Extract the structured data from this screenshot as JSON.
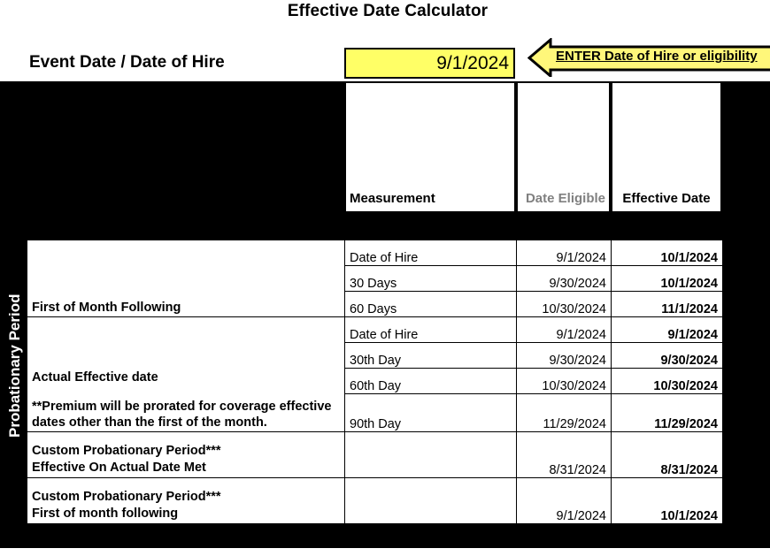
{
  "title": "Effective Date Calculator",
  "event_row": {
    "label": "Event Date / Date of Hire",
    "input_value": "9/1/2024",
    "callout_text": "ENTER Date of Hire or eligibility"
  },
  "side_label": "Probationary Period",
  "headers": {
    "measurement": "Measurement",
    "date_eligible": "Date Eligible",
    "effective_date": "Effective Date"
  },
  "colors": {
    "input_yellow": "#FFFF00",
    "callout_yellow": "#FFF77A",
    "custom_peach": "#F6BE8F",
    "custom_red_text": "#BE0000",
    "eligible_gray": "#8C8C8C",
    "backdrop": "#000000"
  },
  "rows": [
    {
      "category": "First of Month Following",
      "category_note": "",
      "measurement": "Date of Hire",
      "date_eligible": "9/1/2024",
      "effective_date": "10/1/2024"
    },
    {
      "category": "",
      "category_note": "",
      "measurement": "30 Days",
      "date_eligible": "9/30/2024",
      "effective_date": "10/1/2024"
    },
    {
      "category": "",
      "category_note": "",
      "measurement": "60 Days",
      "date_eligible": "10/30/2024",
      "effective_date": "11/1/2024"
    },
    {
      "category": "Actual Effective date",
      "category_note": "**Premium will be prorated for coverage effective dates other than the first of the month.",
      "measurement": "Date of Hire",
      "date_eligible": "9/1/2024",
      "effective_date": "9/1/2024"
    },
    {
      "category": "",
      "category_note": "",
      "measurement": "30th Day",
      "date_eligible": "9/30/2024",
      "effective_date": "9/30/2024"
    },
    {
      "category": "",
      "category_note": "",
      "measurement": "60th Day",
      "date_eligible": "10/30/2024",
      "effective_date": "10/30/2024"
    },
    {
      "category": "",
      "category_note": "",
      "measurement": "90th Day",
      "date_eligible": "11/29/2024",
      "effective_date": "11/29/2024"
    }
  ],
  "custom_rows": [
    {
      "line1": "Custom Probationary Period***",
      "line2": "Effective On Actual Date Met",
      "measurement": "",
      "date_eligible": "8/31/2024",
      "effective_date": "8/31/2024"
    },
    {
      "line1": "Custom Probationary Period***",
      "line2": "First of month following",
      "measurement": "",
      "date_eligible": "9/1/2024",
      "effective_date": "10/1/2024"
    }
  ]
}
